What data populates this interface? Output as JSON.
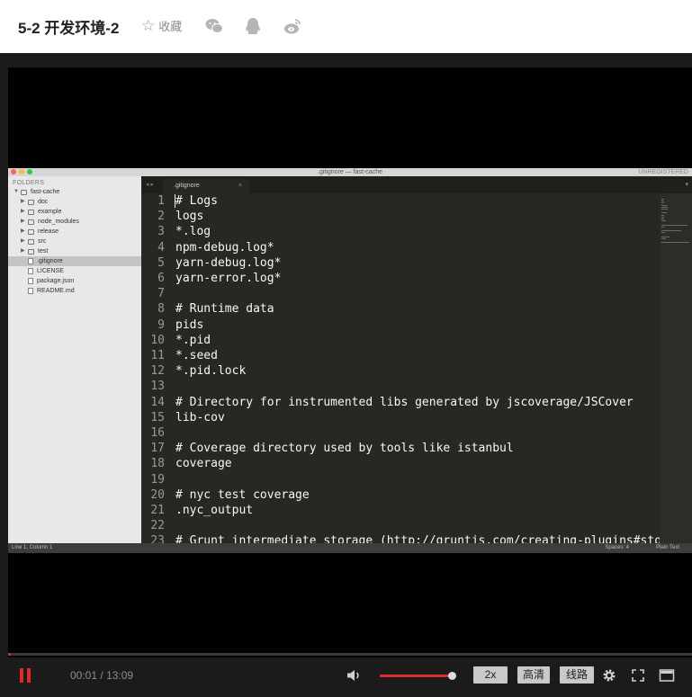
{
  "page": {
    "title": "5-2 开发环境-2",
    "favorite_label": "收藏",
    "share_icons": [
      "wechat-icon",
      "qq-icon",
      "weibo-icon"
    ]
  },
  "editor": {
    "window_title": ".gitignore — fast-cache",
    "unregistered": "UNREGISTERED",
    "sidebar_heading": "FOLDERS",
    "tree": [
      {
        "name": "fast-cache",
        "kind": "folder-open"
      },
      {
        "name": "doc",
        "kind": "folder"
      },
      {
        "name": "example",
        "kind": "folder"
      },
      {
        "name": "node_modules",
        "kind": "folder"
      },
      {
        "name": "release",
        "kind": "folder"
      },
      {
        "name": "src",
        "kind": "folder"
      },
      {
        "name": "test",
        "kind": "folder"
      },
      {
        "name": ".gitignore",
        "kind": "file",
        "selected": true
      },
      {
        "name": "LICENSE",
        "kind": "file"
      },
      {
        "name": "package.json",
        "kind": "file"
      },
      {
        "name": "README.md",
        "kind": "file"
      }
    ],
    "tab_label": ".gitignore",
    "tab_close": "×",
    "nav_arrows": "◂ ▸",
    "tab_menu": "▾",
    "lines": [
      {
        "n": "1",
        "t": "# Logs"
      },
      {
        "n": "2",
        "t": "logs"
      },
      {
        "n": "3",
        "t": "*.log"
      },
      {
        "n": "4",
        "t": "npm-debug.log*"
      },
      {
        "n": "5",
        "t": "yarn-debug.log*"
      },
      {
        "n": "6",
        "t": "yarn-error.log*"
      },
      {
        "n": "7",
        "t": ""
      },
      {
        "n": "8",
        "t": "# Runtime data"
      },
      {
        "n": "9",
        "t": "pids"
      },
      {
        "n": "10",
        "t": "*.pid"
      },
      {
        "n": "11",
        "t": "*.seed"
      },
      {
        "n": "12",
        "t": "*.pid.lock"
      },
      {
        "n": "13",
        "t": ""
      },
      {
        "n": "14",
        "t": "# Directory for instrumented libs generated by jscoverage/JSCover"
      },
      {
        "n": "15",
        "t": "lib-cov"
      },
      {
        "n": "16",
        "t": ""
      },
      {
        "n": "17",
        "t": "# Coverage directory used by tools like istanbul"
      },
      {
        "n": "18",
        "t": "coverage"
      },
      {
        "n": "19",
        "t": ""
      },
      {
        "n": "20",
        "t": "# nyc test coverage"
      },
      {
        "n": "21",
        "t": ".nyc_output"
      },
      {
        "n": "22",
        "t": ""
      },
      {
        "n": "23",
        "t": "# Grunt intermediate storage (http://gruntjs.com/creating-plugins#sto"
      }
    ],
    "status_left": "Line 1, Column 1",
    "status_spaces": "Spaces: 4",
    "status_syntax": "Plain Text"
  },
  "player": {
    "current_time": "00:01",
    "separator": "/",
    "duration": "13:09",
    "progress_fraction": 0.0045,
    "volume_fraction": 1.0,
    "speed_label": "2x",
    "quality_label": "高清",
    "route_label": "线路",
    "accent_color": "#e0282d"
  }
}
